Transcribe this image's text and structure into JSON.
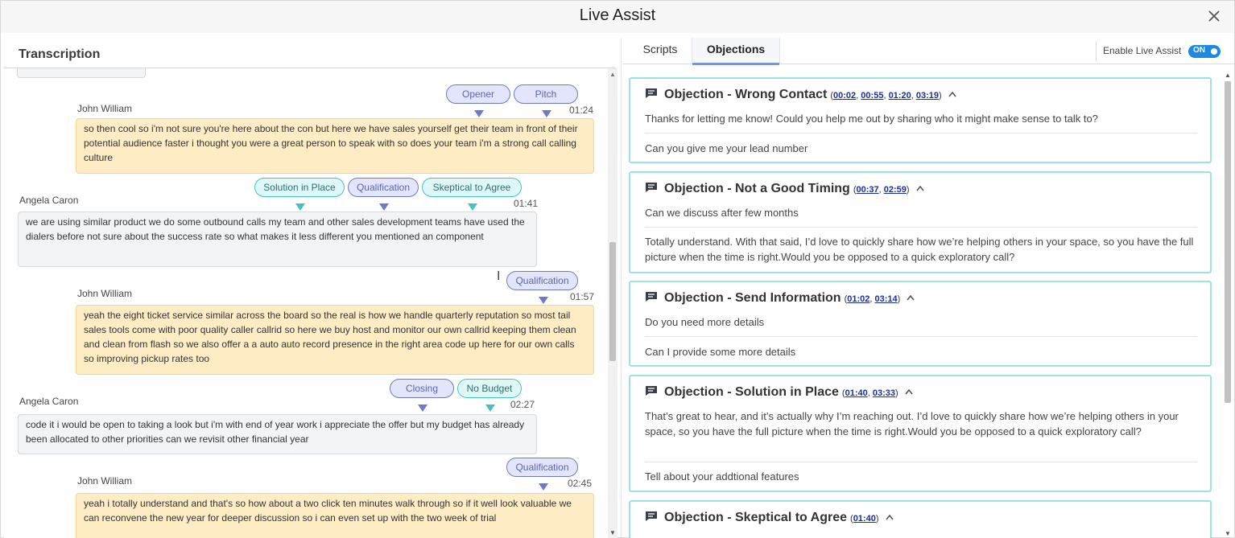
{
  "window": {
    "title": "Live Assist"
  },
  "transcription": {
    "title": "Transcription",
    "messages": [
      {
        "speaker": "John William",
        "time": "01:24",
        "role": "agent",
        "text": "so then cool so i'm not sure you're here about the con but here we have sales yourself get their team in front of their potential audience faster i thought you were a great person to speak with so does your team i'm a strong call calling culture",
        "tags": [
          "Opener",
          "Pitch"
        ]
      },
      {
        "speaker": "Angela Caron",
        "time": "01:41",
        "role": "customer",
        "text": "we are using similar product we do some outbound calls my team and other sales development teams have used the dialers before not sure about the success rate so what makes it less different you mentioned an component",
        "tags": [
          "Solution in Place",
          "Qualification",
          "Skeptical to Agree"
        ]
      },
      {
        "speaker": "John William",
        "time": "01:57",
        "role": "agent",
        "text": "yeah the eight ticket service similar across the board so the real is how we handle quarterly reputation so most tail sales tools come with poor quality caller callrid so here we buy host and monitor our own callrid keeping them clean and clean from flash so we also offer a a auto auto record presence in the right area code up here for our own calls so improving pickup rates too",
        "tags": [
          "Qualification"
        ]
      },
      {
        "speaker": "Angela Caron",
        "time": "02:27",
        "role": "customer",
        "text": "code it i would be open to taking a look but i'm with end of year work i appreciate the offer but my budget has already been allocated to other priorities can we revisit other financial year",
        "tags": [
          "Closing",
          "No Budget"
        ]
      },
      {
        "speaker": "John William",
        "time": "02:45",
        "role": "agent",
        "text": "yeah i totally understand and that's so how about a two click ten minutes walk through so if it well look valuable we can reconvene the new year for deeper discussion so i can even set up with the two week of trial",
        "tags": [
          "Qualification"
        ]
      }
    ]
  },
  "tabs": {
    "scripts": "Scripts",
    "objections": "Objections"
  },
  "live_assist": {
    "label": "Enable Live Assist",
    "state": "ON"
  },
  "objections": [
    {
      "title": "Objection - Wrong Contact",
      "refs": [
        "00:02",
        "00:55",
        "01:20",
        "03:19"
      ],
      "answers": [
        "Thanks for letting me know! Could you help me out by sharing who it might make sense to talk to?",
        "Can you give me your lead number"
      ]
    },
    {
      "title": "Objection - Not a Good Timing",
      "refs": [
        "00:37",
        "02:59"
      ],
      "answers": [
        "Can we discuss after few months",
        "Totally understand. With that said, I’d love to quickly share how we’re helping others in your space, so you have the full picture when the time is right.Would you be opposed to a quick exploratory call?"
      ]
    },
    {
      "title": "Objection - Send Information",
      "refs": [
        "01:02",
        "03:14"
      ],
      "answers": [
        "Do you need more details",
        "Can I provide some more details"
      ]
    },
    {
      "title": "Objection - Solution in Place",
      "refs": [
        "01:40",
        "03:33"
      ],
      "answers": [
        "That’s great to hear, and it’s actually why I’m reaching out. I’d love to quickly share how we’re helping others in your space, so you have the full picture when the time is right.Would you be opposed to a quick exploratory call?",
        "Tell about your addtional features"
      ]
    },
    {
      "title": "Objection - Skeptical to Agree",
      "refs": [
        "01:40"
      ],
      "answers": []
    }
  ],
  "colors": {
    "agent_bubble": "#fdecc4",
    "customer_bubble": "#f3f4f6",
    "tag_purple": "#6f78c9",
    "tag_teal": "#47c1c6",
    "toggle_on": "#1e88e5",
    "card_border": "#9ee0e6"
  },
  "icons": {
    "close": "close-icon",
    "objection": "comment-icon",
    "collapse": "chevron-up-icon"
  }
}
